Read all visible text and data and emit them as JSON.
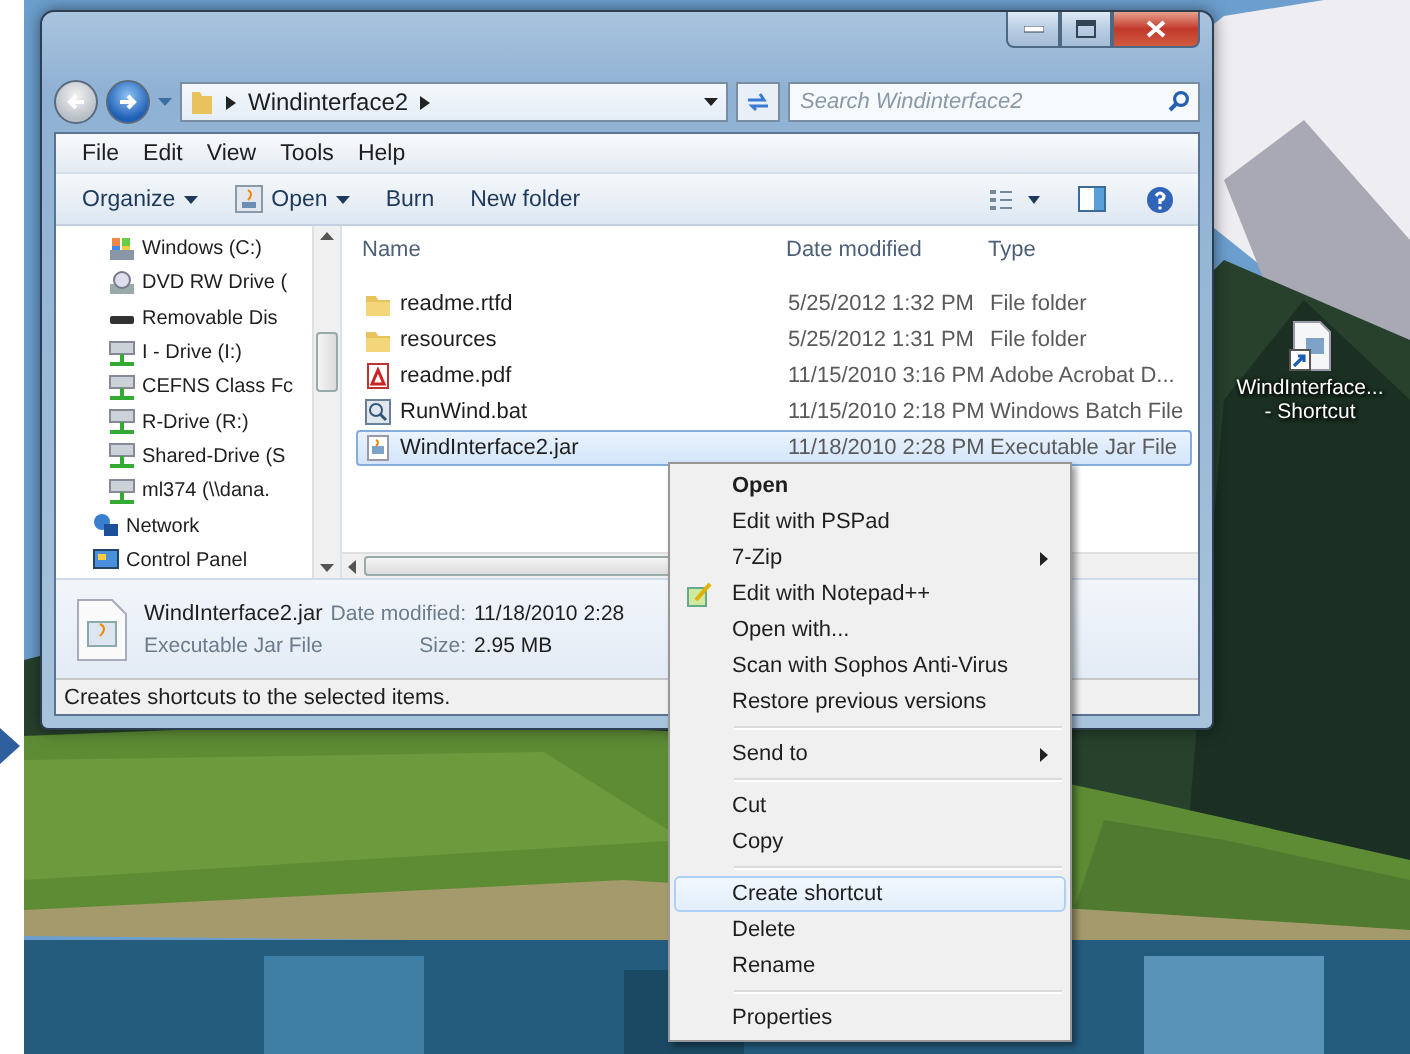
{
  "window": {
    "breadcrumb": "Windinterface2",
    "search": {
      "placeholder": "Search Windinterface2"
    },
    "menubar": [
      "File",
      "Edit",
      "View",
      "Tools",
      "Help"
    ],
    "toolbar": [
      {
        "label": "Organize",
        "kind": "dropdown"
      },
      {
        "label": "Open",
        "kind": "split"
      },
      {
        "label": "Burn",
        "kind": "plain"
      },
      {
        "label": "New folder",
        "kind": "plain"
      }
    ],
    "nav_pane": [
      {
        "label": "Windows (C:)",
        "kind": "drive"
      },
      {
        "label": "DVD RW Drive (",
        "kind": "dvd"
      },
      {
        "label": "Removable Dis",
        "kind": "removable"
      },
      {
        "label": "I - Drive (I:)",
        "kind": "netdrive"
      },
      {
        "label": "CEFNS Class Fc",
        "kind": "netdrive"
      },
      {
        "label": "R-Drive (R:)",
        "kind": "netdrive"
      },
      {
        "label": "Shared-Drive (S",
        "kind": "netdrive"
      },
      {
        "label": "ml374 (\\\\dana.",
        "kind": "netdrive"
      },
      {
        "label": "Network",
        "kind": "network"
      },
      {
        "label": "Control Panel",
        "kind": "control"
      }
    ],
    "columns": [
      "Name",
      "Date modified",
      "Type"
    ],
    "files": [
      {
        "name": "readme.rtfd",
        "date": "5/25/2012 1:32 PM",
        "type": "File folder",
        "kind": "folder",
        "selected": false
      },
      {
        "name": "resources",
        "date": "5/25/2012 1:31 PM",
        "type": "File folder",
        "kind": "folder",
        "selected": false
      },
      {
        "name": "readme.pdf",
        "date": "11/15/2010 3:16 PM",
        "type": "Adobe Acrobat D...",
        "kind": "pdf",
        "selected": false
      },
      {
        "name": "RunWind.bat",
        "date": "11/15/2010 2:18 PM",
        "type": "Windows Batch File",
        "kind": "bat",
        "selected": false
      },
      {
        "name": "WindInterface2.jar",
        "date": "11/18/2010 2:28 PM",
        "type": "Executable Jar File",
        "kind": "jar",
        "selected": true
      }
    ],
    "details": {
      "name": "WindInterface2.jar",
      "date_label": "Date modified:",
      "date": "11/18/2010 2:28",
      "type": "Executable Jar File",
      "size_label": "Size:",
      "size": "2.95 MB"
    },
    "status_bar": "Creates shortcuts to the selected items."
  },
  "context_menu": {
    "groups": [
      [
        {
          "label": "Open",
          "default": true,
          "submenu": false,
          "icon": false,
          "selected": false
        },
        {
          "label": "Edit with PSPad",
          "default": false,
          "submenu": false,
          "icon": false,
          "selected": false
        },
        {
          "label": "7-Zip",
          "default": false,
          "submenu": true,
          "icon": false,
          "selected": false
        },
        {
          "label": "Edit with Notepad++",
          "default": false,
          "submenu": false,
          "icon": true,
          "selected": false
        },
        {
          "label": "Open with...",
          "default": false,
          "submenu": false,
          "icon": false,
          "selected": false
        },
        {
          "label": "Scan with Sophos Anti-Virus",
          "default": false,
          "submenu": false,
          "icon": false,
          "selected": false
        },
        {
          "label": "Restore previous versions",
          "default": false,
          "submenu": false,
          "icon": false,
          "selected": false
        }
      ],
      [
        {
          "label": "Send to",
          "default": false,
          "submenu": true,
          "icon": false,
          "selected": false
        }
      ],
      [
        {
          "label": "Cut",
          "default": false,
          "submenu": false,
          "icon": false,
          "selected": false
        },
        {
          "label": "Copy",
          "default": false,
          "submenu": false,
          "icon": false,
          "selected": false
        }
      ],
      [
        {
          "label": "Create shortcut",
          "default": false,
          "submenu": false,
          "icon": false,
          "selected": true
        },
        {
          "label": "Delete",
          "default": false,
          "submenu": false,
          "icon": false,
          "selected": false
        },
        {
          "label": "Rename",
          "default": false,
          "submenu": false,
          "icon": false,
          "selected": false
        }
      ],
      [
        {
          "label": "Properties",
          "default": false,
          "submenu": false,
          "icon": false,
          "selected": false
        }
      ]
    ]
  },
  "desktop_icons": [
    {
      "lines": [
        "WindInterface...",
        "- Shortcut"
      ]
    }
  ]
}
